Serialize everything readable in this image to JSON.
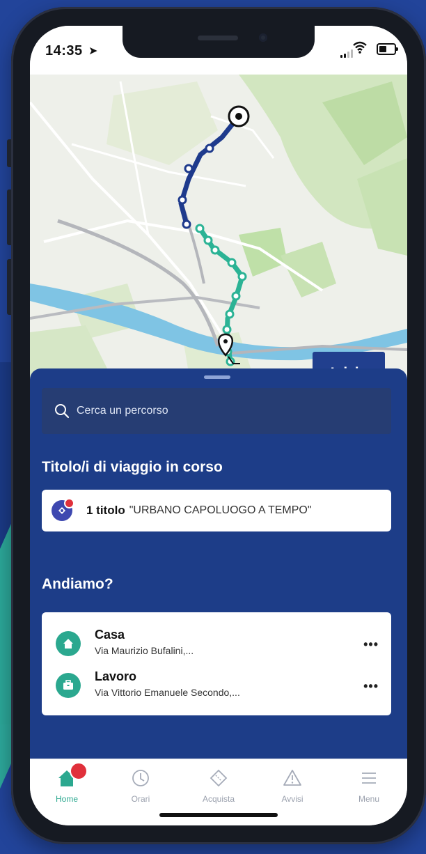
{
  "status_bar": {
    "time": "14:35"
  },
  "map": {
    "start_button_label": "Inizia"
  },
  "search": {
    "placeholder": "Cerca un percorso"
  },
  "tickets_section": {
    "title": "Titolo/i di viaggio in corso",
    "count_label": "1 titolo",
    "ticket_name": "\"URBANO CAPOLUOGO A TEMPO\""
  },
  "places_section": {
    "title": "Andiamo?",
    "items": [
      {
        "title": "Casa",
        "address": "Via Maurizio Bufalini,...",
        "icon": "home-icon"
      },
      {
        "title": "Lavoro",
        "address": "Via Vittorio Emanuele Secondo,...",
        "icon": "briefcase-icon"
      }
    ],
    "more_label": "•••"
  },
  "tabbar": {
    "tabs": [
      {
        "label": "Home",
        "icon": "home-icon",
        "active": true
      },
      {
        "label": "Orari",
        "icon": "clock-icon"
      },
      {
        "label": "Acquista",
        "icon": "ticket-icon"
      },
      {
        "label": "Avvisi",
        "icon": "warning-icon"
      },
      {
        "label": "Menu",
        "icon": "menu-icon"
      }
    ]
  },
  "colors": {
    "primary": "#1d3d88",
    "accent": "#2ba88f",
    "route_dark": "#1e3a8c",
    "route_teal": "#2bb395",
    "badge": "#e0303b"
  }
}
